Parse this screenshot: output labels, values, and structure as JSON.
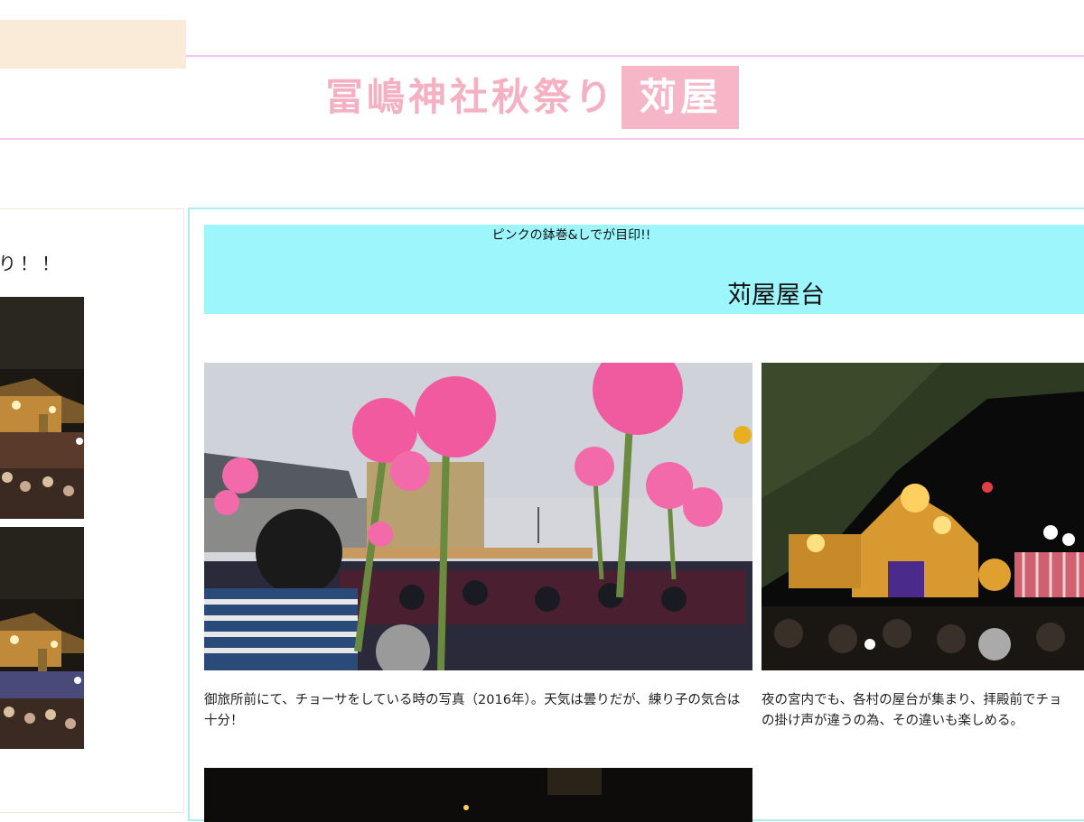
{
  "header": {
    "title_main": "冨嶋神社秋祭り",
    "title_box": "苅屋",
    "line_color": "#f3c7ee",
    "title_color": "#f6b0c4",
    "box_color": "#f7b6c8"
  },
  "sidebar": {
    "heading_fragment": "り！！",
    "heading_bg": "#faebd8"
  },
  "main": {
    "banner_bg": "#9cf6fb",
    "banner_subtitle": "ピンクの鉢巻&しでが目印!!",
    "banner_title": "苅屋屋台",
    "captions": [
      "御旅所前にて、チョーサをしている時の写真（2016年）。天気は曇りだが、練り子の気合は十分！",
      "夜の宮内でも、各村の屋台が集まり、拝殿前でチョ⁠の掛け声が違うの為、その違いも楽しめる。"
    ]
  }
}
